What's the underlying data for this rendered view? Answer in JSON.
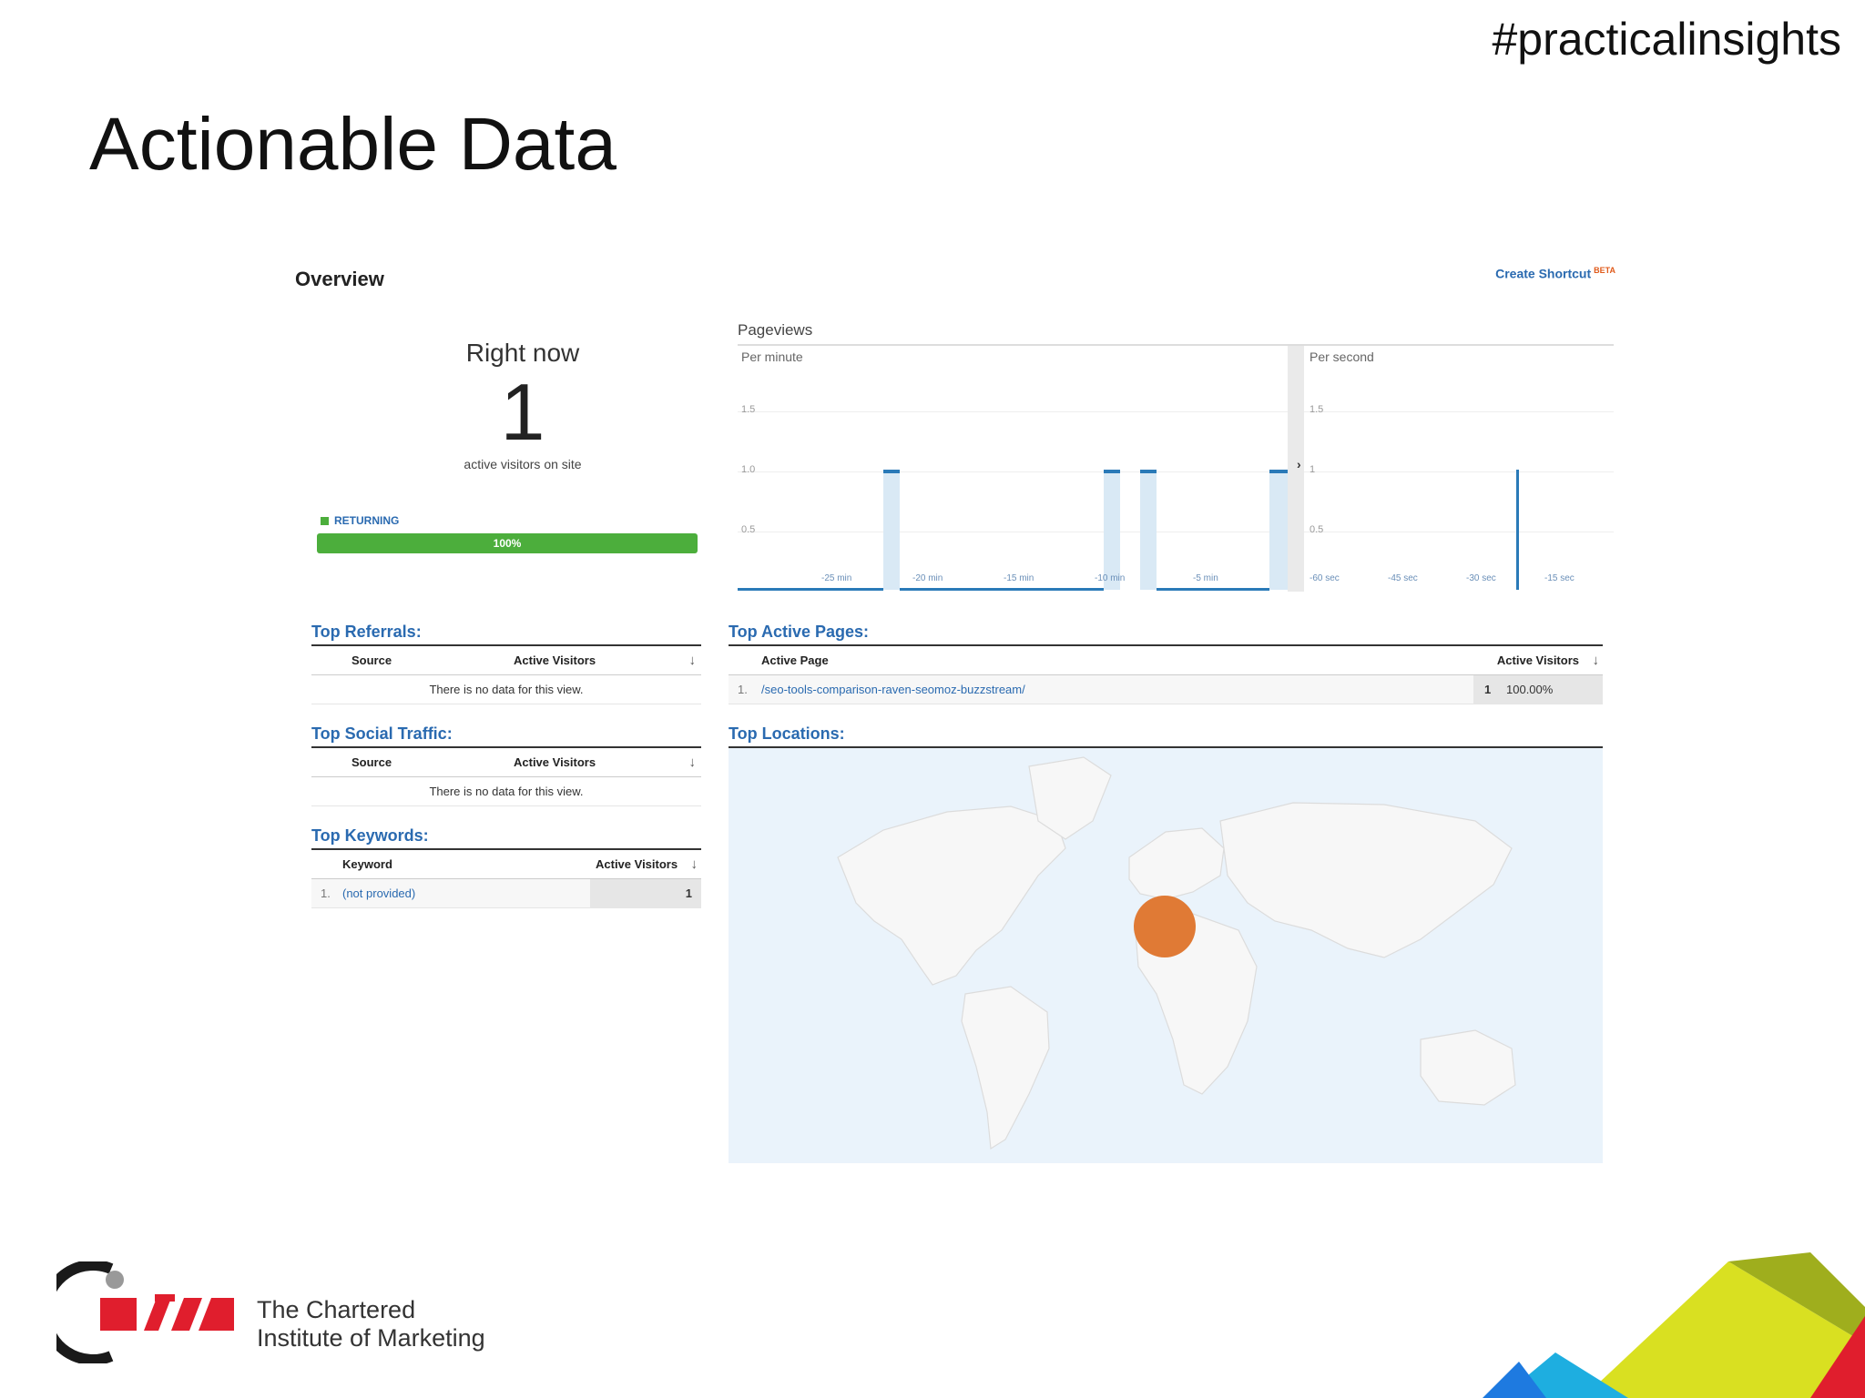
{
  "slide": {
    "hashtag": "#practicalinsights",
    "title": "Actionable Data"
  },
  "ga": {
    "overview": "Overview",
    "create_shortcut": "Create Shortcut",
    "beta": "BETA",
    "right_now": {
      "title": "Right now",
      "count": "1",
      "subtitle": "active visitors on site",
      "returning_label": "RETURNING",
      "returning_percent": "100%",
      "returning_fraction": 1.0
    },
    "pageviews": {
      "label": "Pageviews",
      "per_minute": "Per minute",
      "per_second": "Per second",
      "y_ticks_minute": [
        "1.5",
        "1.0",
        "0.5"
      ],
      "y_ticks_second": [
        "1.5",
        "1",
        "0.5"
      ],
      "x_ticks_minute": [
        "-25 min",
        "-20 min",
        "-15 min",
        "-10 min",
        "-5 min"
      ],
      "x_ticks_second": [
        "-60 sec",
        "-45 sec",
        "-30 sec",
        "-15 sec"
      ]
    },
    "top_referrals": {
      "title": "Top Referrals:",
      "col_source": "Source",
      "col_visitors": "Active Visitors",
      "empty": "There is no data for this view."
    },
    "top_social": {
      "title": "Top Social Traffic:",
      "col_source": "Source",
      "col_visitors": "Active Visitors",
      "empty": "There is no data for this view."
    },
    "top_keywords": {
      "title": "Top Keywords:",
      "col_keyword": "Keyword",
      "col_visitors": "Active Visitors",
      "rows": [
        {
          "index": "1.",
          "keyword": "(not provided)",
          "visitors": "1"
        }
      ]
    },
    "top_pages": {
      "title": "Top Active Pages:",
      "col_page": "Active Page",
      "col_visitors": "Active Visitors",
      "rows": [
        {
          "index": "1.",
          "page": "/seo-tools-comparison-raven-seomoz-buzzstream/",
          "visitors": "1",
          "percent": "100.00%"
        }
      ]
    },
    "top_locations": {
      "title": "Top Locations:"
    }
  },
  "footer": {
    "org_line1": "The Chartered",
    "org_line2": "Institute of Marketing"
  },
  "colors": {
    "accent_blue": "#2a6ab0",
    "returning_green": "#4cae3c",
    "location_marker": "#e07a35",
    "cim_red": "#e01e2d"
  }
}
